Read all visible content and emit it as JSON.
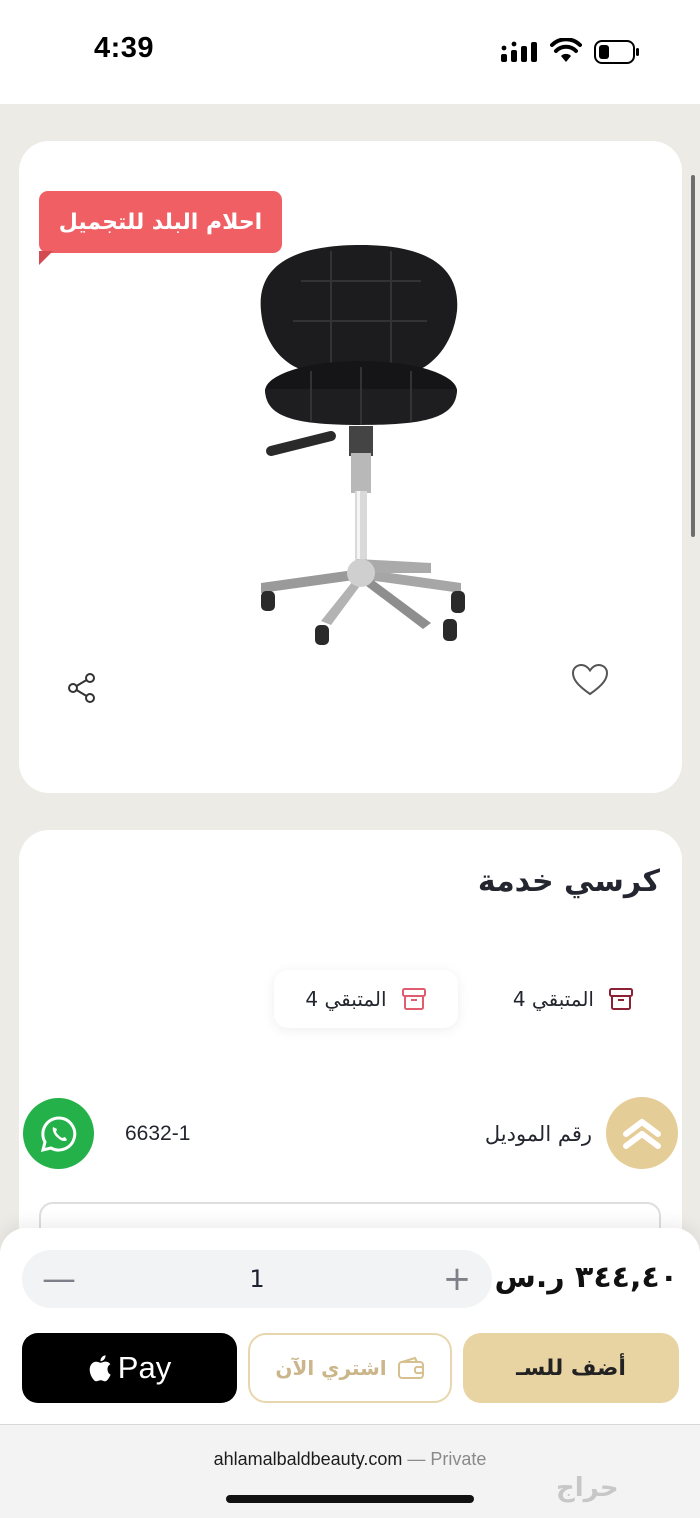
{
  "status_bar": {
    "time": "4:39"
  },
  "product_image": {
    "brand_ribbon": "احلام البلد للتجميل"
  },
  "product": {
    "title": "كرسي خدمة",
    "stock": [
      {
        "label": "المتبقي 4",
        "icon": "archive-box-icon"
      },
      {
        "label": "المتبقي 4",
        "icon": "archive-box-icon"
      }
    ],
    "model_label": "رقم الموديل",
    "model_value": "6632-1"
  },
  "floating": {
    "whatsapp_icon": "whatsapp-icon",
    "scroll_top_icon": "chevron-up-icon"
  },
  "purchase": {
    "quantity": "1",
    "minus": "—",
    "plus": "+",
    "price": "٣٤٤,٤٠ ر.س",
    "apple_pay_label": "Pay",
    "buy_now_label": "اشتري الآن",
    "add_to_cart_label": "أضف للسـ"
  },
  "browser": {
    "url": "ahlamalbaldbeauty.com",
    "separator": " — ",
    "private_label": "Private",
    "watermark": "حراج"
  },
  "colors": {
    "ribbon": "#ef5f64",
    "whatsapp": "#25b14a",
    "gold": "#e8d3a3",
    "gold_outline": "#e8d7ae"
  }
}
